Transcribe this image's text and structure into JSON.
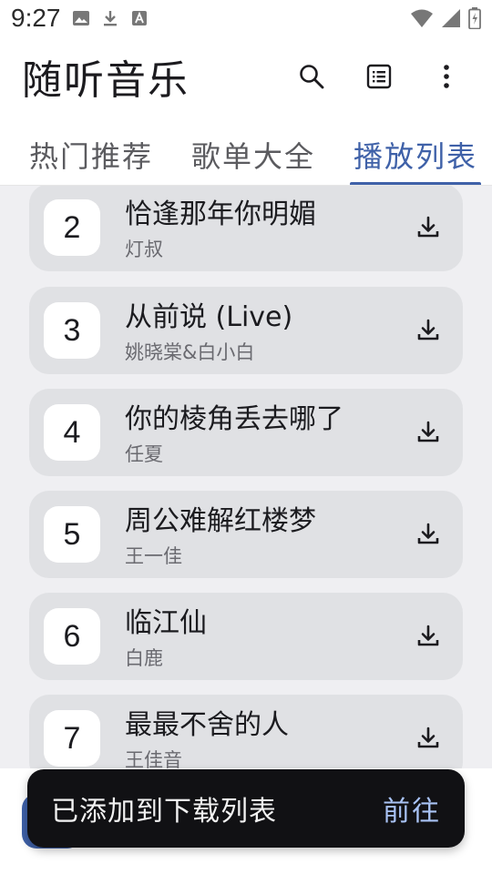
{
  "status_bar": {
    "time": "9:27",
    "left_icons": [
      "image-icon",
      "download-icon",
      "text-a-icon"
    ],
    "right_icons": [
      "wifi-icon",
      "signal-icon",
      "battery-icon"
    ]
  },
  "app": {
    "title": "随听音乐",
    "actions": [
      "search-icon",
      "list-icon",
      "more-vert-icon"
    ]
  },
  "tabs": [
    {
      "label": "热门推荐",
      "active": false
    },
    {
      "label": "歌单大全",
      "active": false
    },
    {
      "label": "播放列表",
      "active": true
    }
  ],
  "songs": [
    {
      "number": "2",
      "title": "恰逢那年你明媚",
      "artist": "灯叔"
    },
    {
      "number": "3",
      "title": "从前说 (Live)",
      "artist": "姚晓棠&白小白"
    },
    {
      "number": "4",
      "title": "你的棱角丢去哪了",
      "artist": "任夏"
    },
    {
      "number": "5",
      "title": "周公难解红楼梦",
      "artist": "王一佳"
    },
    {
      "number": "6",
      "title": "临江仙",
      "artist": "白鹿"
    },
    {
      "number": "7",
      "title": "最最不舍的人",
      "artist": "王佳音"
    }
  ],
  "snackbar": {
    "message": "已添加到下载列表",
    "action": "前往"
  },
  "colors": {
    "accent": "#3f61a8",
    "card": "#e0e1e4",
    "list_background": "#efeff2",
    "snackbar": "#111114",
    "snackbar_action": "#a9c3f5"
  }
}
